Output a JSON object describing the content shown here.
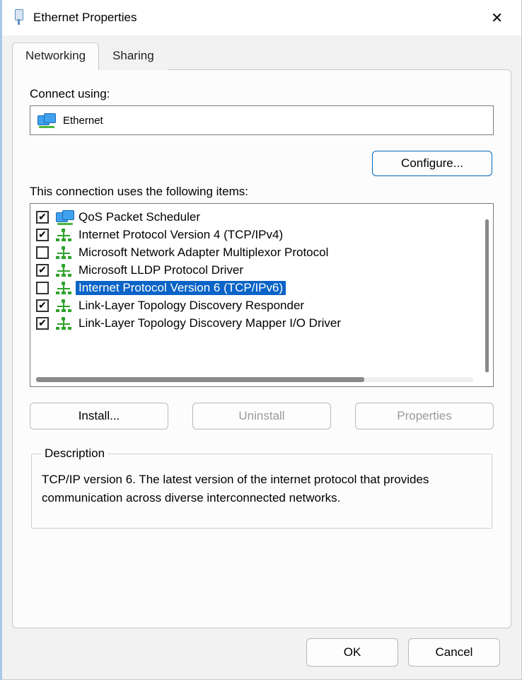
{
  "window": {
    "title": "Ethernet Properties"
  },
  "tabs": {
    "networking": "Networking",
    "sharing": "Sharing"
  },
  "labels": {
    "connect_using": "Connect using:",
    "items_heading": "This connection uses the following items:",
    "description_legend": "Description"
  },
  "adapter": {
    "name": "Ethernet"
  },
  "buttons": {
    "configure": "Configure...",
    "install": "Install...",
    "uninstall": "Uninstall",
    "properties": "Properties",
    "ok": "OK",
    "cancel": "Cancel"
  },
  "items": [
    {
      "checked": true,
      "icon": "monitors",
      "label": "QoS Packet Scheduler",
      "selected": false
    },
    {
      "checked": true,
      "icon": "net",
      "label": "Internet Protocol Version 4 (TCP/IPv4)",
      "selected": false
    },
    {
      "checked": false,
      "icon": "net",
      "label": "Microsoft Network Adapter Multiplexor Protocol",
      "selected": false
    },
    {
      "checked": true,
      "icon": "net",
      "label": "Microsoft LLDP Protocol Driver",
      "selected": false
    },
    {
      "checked": false,
      "icon": "net",
      "label": "Internet Protocol Version 6 (TCP/IPv6)",
      "selected": true
    },
    {
      "checked": true,
      "icon": "net",
      "label": "Link-Layer Topology Discovery Responder",
      "selected": false
    },
    {
      "checked": true,
      "icon": "net",
      "label": "Link-Layer Topology Discovery Mapper I/O Driver",
      "selected": false
    }
  ],
  "description": {
    "text": "TCP/IP version 6. The latest version of the internet protocol that provides communication across diverse interconnected networks."
  }
}
